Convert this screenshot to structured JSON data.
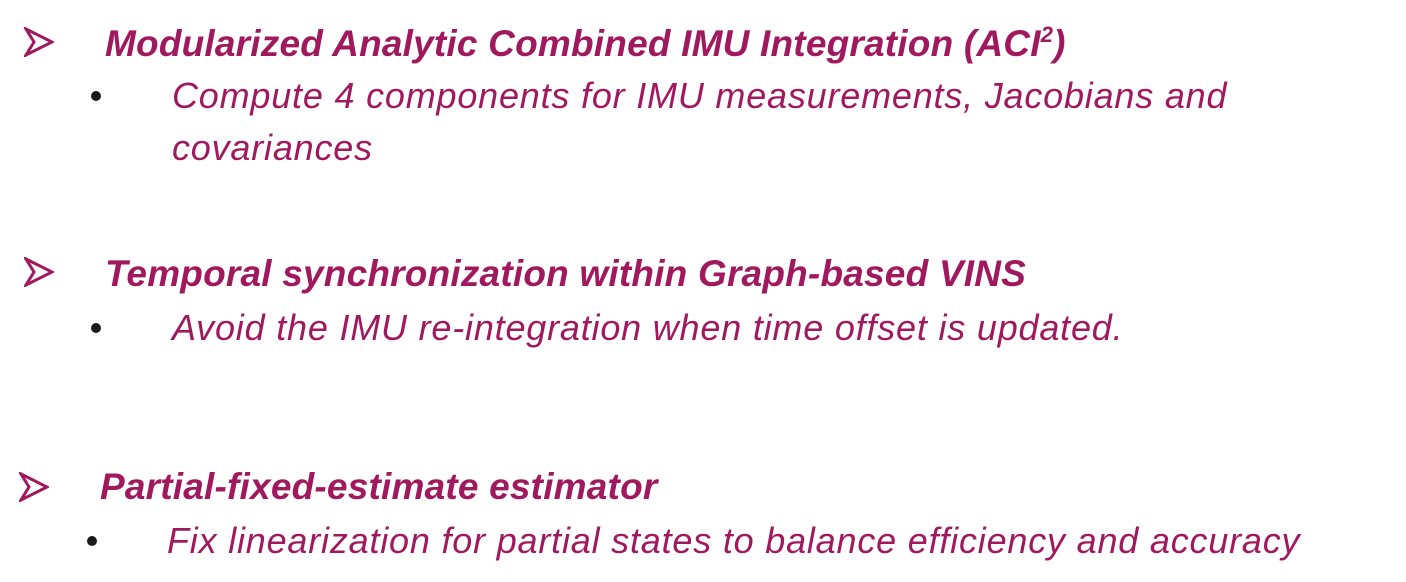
{
  "items": [
    {
      "icon": "arrow-bullet-icon",
      "heading_main": "Modularized Analytic Combined IMU Integration (ACI",
      "heading_sup": "2",
      "heading_end": ")",
      "sub": {
        "bullet": "•",
        "line1": "Compute 4 components for IMU measurements, Jacobians and",
        "line2": "covariances"
      }
    },
    {
      "icon": "arrow-bullet-icon",
      "heading_main": "Temporal synchronization within Graph-based VINS",
      "sub": {
        "bullet": "•",
        "line1": "Avoid the IMU re-integration when time offset is updated."
      }
    },
    {
      "icon": "arrow-bullet-icon",
      "heading_main": "Partial-fixed-estimate estimator",
      "sub": {
        "bullet": "•",
        "line1": "Fix linearization for partial states to balance efficiency and accuracy"
      }
    }
  ],
  "colors": {
    "accent": "#a0195f",
    "bullet": "#1a1a1a",
    "background": "#ffffff"
  }
}
